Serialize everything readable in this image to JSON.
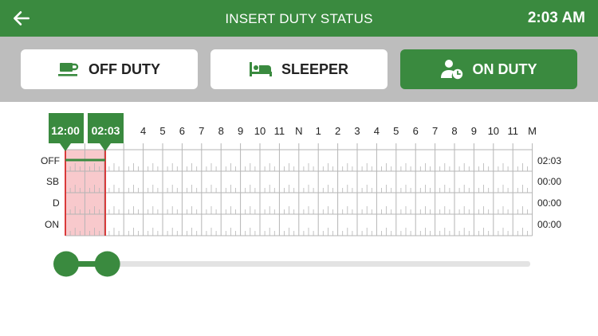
{
  "header": {
    "title": "INSERT DUTY STATUS",
    "time": "2:03 AM"
  },
  "tabs": [
    {
      "label": "OFF DUTY",
      "icon": "coffee-cup-icon",
      "active": false
    },
    {
      "label": "SLEEPER",
      "icon": "bed-icon",
      "active": false
    },
    {
      "label": "ON DUTY",
      "icon": "person-clock-icon",
      "active": true
    }
  ],
  "graph": {
    "hour_labels": [
      "4",
      "5",
      "6",
      "7",
      "8",
      "9",
      "10",
      "11",
      "N",
      "1",
      "2",
      "3",
      "4",
      "5",
      "6",
      "7",
      "8",
      "9",
      "10",
      "11",
      "M"
    ],
    "rows": [
      {
        "label": "OFF",
        "total": "02:03"
      },
      {
        "label": "SB",
        "total": "00:00"
      },
      {
        "label": "D",
        "total": "00:00"
      },
      {
        "label": "ON",
        "total": "00:00"
      }
    ],
    "selection": {
      "start_label": "12:00",
      "end_label": "02:03",
      "start_hour": 0,
      "end_hour": 2.05
    }
  },
  "slider": {
    "start_fraction": 0,
    "end_fraction": 0.087
  },
  "colors": {
    "brand_green": "#3a8a3f",
    "selection_fill": "#f8c9cc",
    "selection_edge": "#d93a3a",
    "grid": "#b5b5b5",
    "tab_bar": "#bdbdbd"
  }
}
